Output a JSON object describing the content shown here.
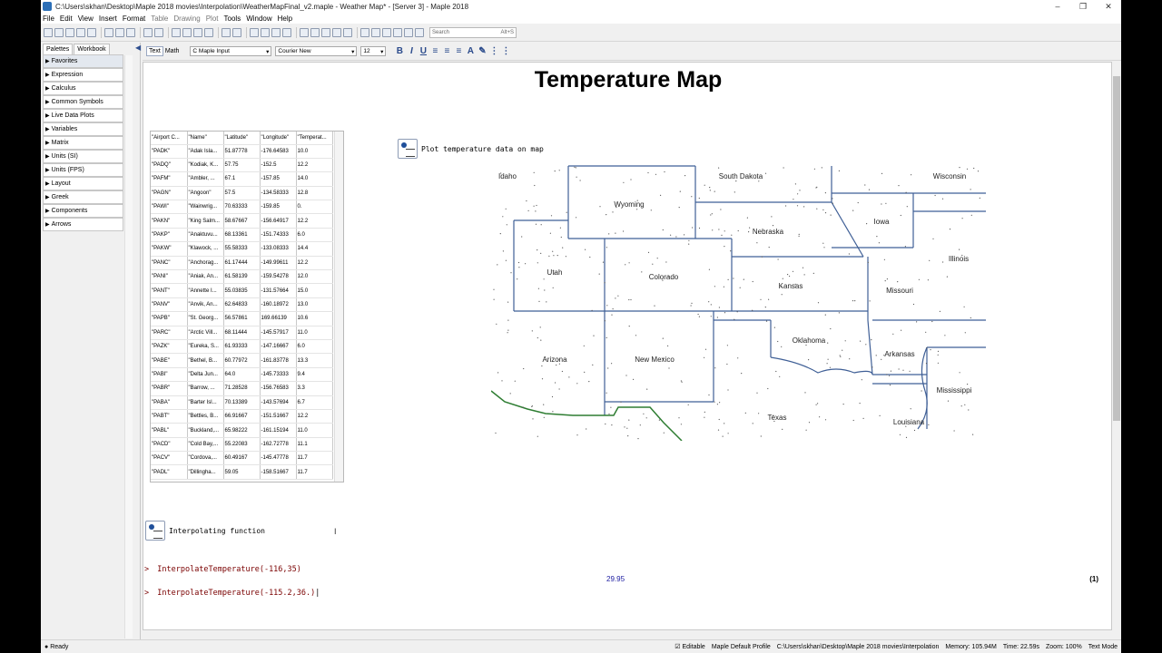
{
  "window": {
    "title": "C:\\Users\\skhan\\Desktop\\Maple 2018 movies\\Interpolation\\WeatherMapFinal_v2.maple - Weather Map* - [Server 3] - Maple 2018",
    "controls": [
      "–",
      "❐",
      "✕"
    ]
  },
  "menu": [
    "File",
    "Edit",
    "View",
    "Insert",
    "Format",
    "Table",
    "Drawing",
    "Plot",
    "Tools",
    "Window",
    "Help"
  ],
  "toolbar": {
    "search_placeholder": "Search",
    "search_shortcut": "Alt+S"
  },
  "palettes": {
    "tabs": [
      "Palettes",
      "Workbook"
    ],
    "items": [
      "Favorites",
      "Expression",
      "Calculus",
      "Common Symbols",
      "Live Data Plots",
      "Variables",
      "Matrix",
      "Units (SI)",
      "Units (FPS)",
      "Layout",
      "Greek",
      "Components",
      "Arrows"
    ]
  },
  "context": {
    "text_mode": "Text",
    "math_mode": "Math",
    "style": "C  Maple Input",
    "font": "Courier New",
    "size": "12"
  },
  "document": {
    "title": "Temperature Map",
    "table_headers": [
      "\"Airport C...",
      "\"Name\"",
      "\"Latitude\"",
      "\"Longitude\"",
      "\"Temperat..."
    ],
    "table_rows": [
      [
        "\"PADK\"",
        "\"Adak Isla...",
        "51.87778",
        "-176.64583",
        "10.0"
      ],
      [
        "\"PADQ\"",
        "\"Kodiak, K...",
        "57.75",
        "-152.5",
        "12.2"
      ],
      [
        "\"PAFM\"",
        "\"Ambler, ...",
        "67.1",
        "-157.85",
        "14.0"
      ],
      [
        "\"PAGN\"",
        "\"Angoon\"",
        "57.5",
        "-134.58333",
        "12.8"
      ],
      [
        "\"PAWI\"",
        "\"Wainwrig...",
        "70.63333",
        "-159.85",
        "0."
      ],
      [
        "\"PAKN\"",
        "\"King Salm...",
        "58.67667",
        "-156.64917",
        "12.2"
      ],
      [
        "\"PAKP\"",
        "\"Anaktuvu...",
        "68.13361",
        "-151.74333",
        "6.0"
      ],
      [
        "\"PAKW\"",
        "\"Klawock, ...",
        "55.58333",
        "-133.08333",
        "14.4"
      ],
      [
        "\"PANC\"",
        "\"Anchorag...",
        "61.17444",
        "-149.99611",
        "12.2"
      ],
      [
        "\"PANI\"",
        "\"Aniak, An...",
        "61.58139",
        "-159.54278",
        "12.0"
      ],
      [
        "\"PANT\"",
        "\"Annette I...",
        "55.03835",
        "-131.57664",
        "15.0"
      ],
      [
        "\"PANV\"",
        "\"Anvik, An...",
        "62.64833",
        "-160.18972",
        "13.0"
      ],
      [
        "\"PAPB\"",
        "\"St. Georg...",
        "56.57861",
        "169.66139",
        "10.6"
      ],
      [
        "\"PARC\"",
        "\"Arctic Vill...",
        "68.11444",
        "-145.57917",
        "11.0"
      ],
      [
        "\"PAZK\"",
        "\"Eureka, S...",
        "61.93333",
        "-147.16667",
        "6.0"
      ],
      [
        "\"PABE\"",
        "\"Bethel, B...",
        "60.77972",
        "-161.83778",
        "13.3"
      ],
      [
        "\"PABI\"",
        "\"Delta Jun...",
        "64.0",
        "-145.73333",
        "9.4"
      ],
      [
        "\"PABR\"",
        "\"Barrow, ...",
        "71.28528",
        "-156.76583",
        "3.3"
      ],
      [
        "\"PABA\"",
        "\"Barter Isl...",
        "70.13389",
        "-143.57694",
        "6.7"
      ],
      [
        "\"PABT\"",
        "\"Bettles, B...",
        "66.91667",
        "-151.51667",
        "12.2"
      ],
      [
        "\"PABL\"",
        "\"Buckland,...",
        "65.98222",
        "-161.15194",
        "11.0"
      ],
      [
        "\"PACD\"",
        "\"Cold Bay,...",
        "55.22083",
        "-162.72778",
        "11.1"
      ],
      [
        "\"PACV\"",
        "\"Cordova,...",
        "60.49167",
        "-145.47778",
        "11.7"
      ],
      [
        "\"PADL\"",
        "\"Dillingha...",
        "59.05",
        "-158.51667",
        "11.7"
      ]
    ],
    "section_map": "Plot temperature data on map",
    "map_labels": [
      "Idaho",
      "South Dakota",
      "Wisconsin",
      "Wyoming",
      "Iowa",
      "Nebraska",
      "Illinois",
      "Utah",
      "Colorado",
      "Kansas",
      "Missouri",
      "Oklahoma",
      "Arizona",
      "New Mexico",
      "Arkansas",
      "Mississippi",
      "Texas",
      "Louisiana"
    ],
    "section_interp": "Interpolating function",
    "prompt_symbol": ">",
    "input1": "InterpolateTemperature(-116,35)",
    "output1": "29.95",
    "eqno1": "(1)",
    "input2": "InterpolateTemperature(-115.2,36.)"
  },
  "status": {
    "ready": "Ready",
    "editable": "Editable",
    "profile": "Maple Default Profile",
    "path": "C:\\Users\\skhan\\Desktop\\Maple 2018 movies\\Interpolation",
    "memory": "Memory: 105.94M",
    "time": "Time: 22.59s",
    "zoom": "Zoom: 100%",
    "mode": "Text Mode"
  }
}
